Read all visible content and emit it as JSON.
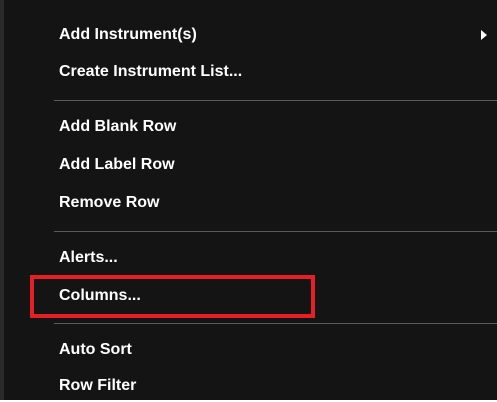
{
  "menu": {
    "items": [
      {
        "label": "Add Instrument(s)",
        "icon": "chevron-right-icon"
      },
      {
        "label": "Create Instrument List..."
      },
      {
        "label": "Add Blank Row"
      },
      {
        "label": "Add Label Row"
      },
      {
        "label": "Remove Row"
      },
      {
        "label": "Alerts..."
      },
      {
        "label": "Columns..."
      },
      {
        "label": "Auto Sort"
      },
      {
        "label": "Row Filter"
      }
    ]
  },
  "highlight_color": "#e61e25"
}
